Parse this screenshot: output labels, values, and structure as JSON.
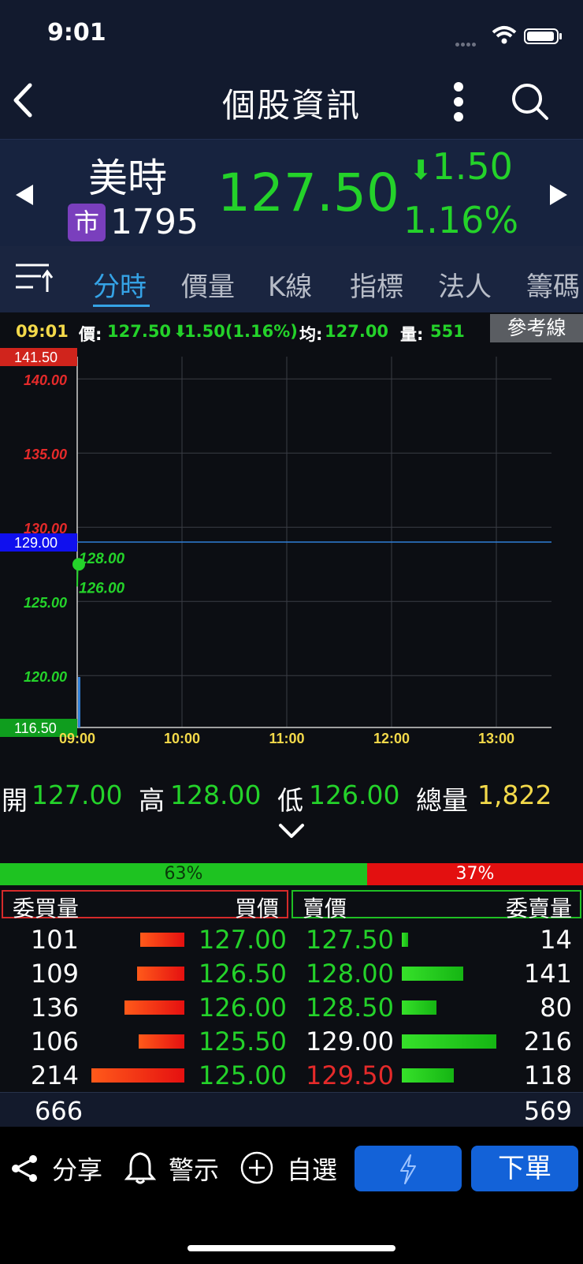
{
  "status": {
    "time": "9:01"
  },
  "nav": {
    "title": "個股資訊"
  },
  "stock": {
    "name": "美時",
    "market_badge": "市",
    "code": "1795",
    "price": "127.50",
    "change": "1.50",
    "change_pct": "1.16%"
  },
  "tabs": [
    {
      "label": "分時",
      "active": true
    },
    {
      "label": "價量"
    },
    {
      "label": "K線"
    },
    {
      "label": "指標"
    },
    {
      "label": "法人"
    },
    {
      "label": "籌碼"
    }
  ],
  "chart_info": {
    "time": "09:01",
    "price_label": "價:",
    "price_value": "127.50",
    "change_value": "1.50(1.16%)",
    "avg_label": "均:",
    "avg_value": "127.00",
    "vol_label": "量:",
    "vol_value": "551",
    "ref_button": "參考線"
  },
  "chart_data": {
    "type": "line",
    "y_range": [
      116.5,
      141.5
    ],
    "limit_up": "141.50",
    "limit_down": "116.50",
    "reference": "129.00",
    "y_ticks": [
      "140.00",
      "135.00",
      "130.00",
      "125.00",
      "120.00"
    ],
    "x_ticks": [
      "09:00",
      "10:00",
      "11:00",
      "12:00",
      "13:00"
    ],
    "high_label": "128.00",
    "low_label": "126.00",
    "series": [
      {
        "x": [
          "09:00",
          "09:01"
        ],
        "values": [
          126.0,
          127.5
        ]
      }
    ],
    "volume": [
      551
    ]
  },
  "ohlc": {
    "open_label": "開",
    "open": "127.00",
    "high_label": "高",
    "high": "128.00",
    "low_label": "低",
    "low": "126.00",
    "vol_label": "總量",
    "vol": "1,822"
  },
  "ratio": {
    "buy": "63%",
    "sell": "37%",
    "buy_fraction": 0.63
  },
  "orderbook": {
    "headers": {
      "bid_qty": "委買量",
      "bid_price": "買價",
      "ask_price": "賣價",
      "ask_qty": "委賣量"
    },
    "rows": [
      {
        "bid_qty": "101",
        "bid_price": "127.00",
        "ask_price": "127.50",
        "ask_qty": "14",
        "ask_color": "#24d22a"
      },
      {
        "bid_qty": "109",
        "bid_price": "126.50",
        "ask_price": "128.00",
        "ask_qty": "141",
        "ask_color": "#24d22a"
      },
      {
        "bid_qty": "136",
        "bid_price": "126.00",
        "ask_price": "128.50",
        "ask_qty": "80",
        "ask_color": "#24d22a"
      },
      {
        "bid_qty": "106",
        "bid_price": "125.50",
        "ask_price": "129.00",
        "ask_qty": "216",
        "ask_color": "#ffffff"
      },
      {
        "bid_qty": "214",
        "bid_price": "125.00",
        "ask_price": "129.50",
        "ask_qty": "118",
        "ask_color": "#e52a2a"
      }
    ],
    "bid_total": "666",
    "ask_total": "569"
  },
  "bottom": {
    "share": "分享",
    "alert": "警示",
    "watch": "自選",
    "order": "下單"
  },
  "colors": {
    "up": "#e52a2a",
    "down": "#24d22a",
    "accent": "#35a3e6"
  }
}
